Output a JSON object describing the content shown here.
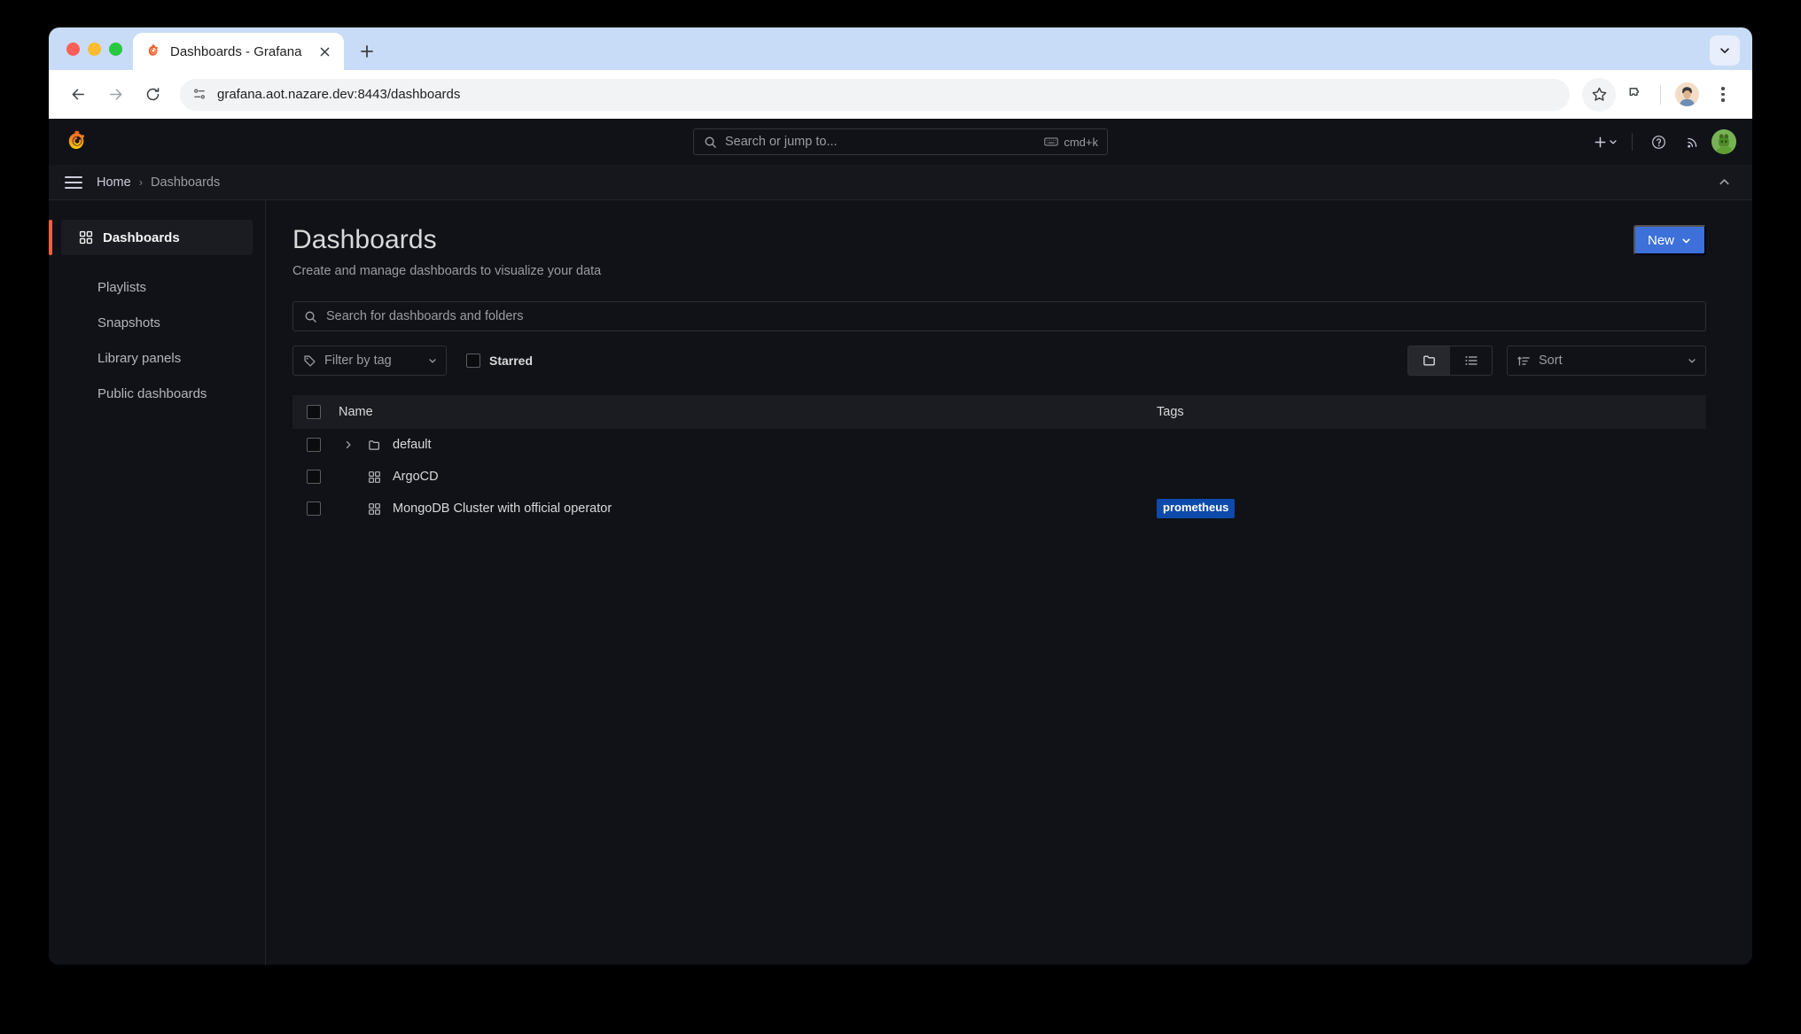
{
  "browser": {
    "tab": {
      "title": "Dashboards - Grafana",
      "favicon_icon": "grafana-favicon-icon",
      "close_icon": "close-icon"
    },
    "new_tab_icon": "plus-icon",
    "tab_list_icon": "chevron-down-icon",
    "toolbar": {
      "back_icon": "back-arrow-icon",
      "forward_icon": "forward-arrow-icon",
      "reload_icon": "reload-icon",
      "site_info_icon": "site-settings-icon",
      "url": "grafana.aot.nazare.dev:8443/dashboards",
      "bookmark_icon": "star-icon",
      "extensions_icon": "puzzle-piece-icon",
      "profile_icon": "profile-avatar-icon",
      "menu_icon": "three-dot-menu-icon"
    }
  },
  "grafana": {
    "topbar": {
      "logo_icon": "grafana-logo-icon",
      "search_placeholder": "Search or jump to...",
      "search_icon": "search-icon",
      "shortcut_label": "cmd+k",
      "shortcut_icon": "keyboard-icon",
      "add_icon": "plus-icon",
      "add_chevron_icon": "chevron-down-icon",
      "help_icon": "help-circle-icon",
      "news_icon": "rss-icon",
      "avatar_icon": "user-avatar-icon"
    },
    "breadcrumb": {
      "menu_icon": "hamburger-menu-icon",
      "home": "Home",
      "separator": "›",
      "current": "Dashboards",
      "collapse_icon": "chevron-up-icon"
    },
    "sidebar": {
      "items": [
        {
          "label": "Dashboards",
          "icon": "dashboards-grid-icon",
          "active": true
        },
        {
          "label": "Playlists",
          "icon": "",
          "active": false
        },
        {
          "label": "Snapshots",
          "icon": "",
          "active": false
        },
        {
          "label": "Library panels",
          "icon": "",
          "active": false
        },
        {
          "label": "Public dashboards",
          "icon": "",
          "active": false
        }
      ]
    },
    "page": {
      "title": "Dashboards",
      "subtitle": "Create and manage dashboards to visualize your data",
      "new_button": {
        "label": "New",
        "chevron_icon": "chevron-down-icon",
        "color": "#3d71d9"
      },
      "search": {
        "placeholder": "Search for dashboards and folders",
        "icon": "search-icon",
        "value": ""
      },
      "filters": {
        "tag_filter": {
          "label": "Filter by tag",
          "icon": "tag-icon",
          "chevron_icon": "chevron-down-icon"
        },
        "starred": {
          "label": "Starred",
          "checked": false
        },
        "view_toggle": {
          "folder_icon": "folder-icon",
          "list_icon": "list-icon",
          "active": "folder"
        },
        "sort": {
          "label": "Sort",
          "icon": "sort-amount-up-icon",
          "chevron_icon": "chevron-down-icon"
        }
      },
      "table": {
        "select_all_checked": false,
        "columns": [
          "Name",
          "Tags"
        ],
        "rows": [
          {
            "name": "default",
            "type": "folder",
            "icon": "folder-icon",
            "expand_icon": "chevron-right-icon",
            "expandable": true,
            "checked": false,
            "tags": []
          },
          {
            "name": "ArgoCD",
            "type": "dashboard",
            "icon": "dashboard-grid-icon",
            "expandable": false,
            "checked": false,
            "tags": []
          },
          {
            "name": "MongoDB Cluster with official operator",
            "type": "dashboard",
            "icon": "dashboard-grid-icon",
            "expandable": false,
            "checked": false,
            "tags": [
              "prometheus"
            ]
          }
        ]
      }
    }
  }
}
